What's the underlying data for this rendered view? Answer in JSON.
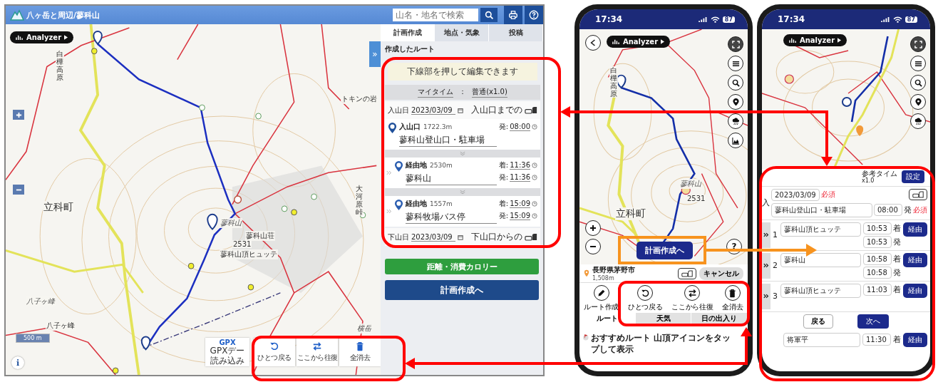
{
  "web_app": {
    "title": "八ヶ岳と周辺/蓼科山",
    "search": {
      "placeholder": "山名・地名で検索"
    },
    "map": {
      "analyzer": "Analyzer",
      "labels": [
        {
          "text": "白樺高原",
          "kind": "vertical"
        },
        {
          "text": "立科町",
          "kind": "town"
        },
        {
          "text": "蓼科山",
          "kind": "peak"
        },
        {
          "text": "蓼科山荘",
          "kind": "place"
        },
        {
          "text": "2531",
          "kind": "place"
        },
        {
          "text": "蓼科山頂ヒュッテ",
          "kind": "place"
        },
        {
          "text": "トキンの岩",
          "kind": "place"
        },
        {
          "text": "大河原峠",
          "kind": "vertical"
        },
        {
          "text": "八子ヶ峰",
          "kind": "peak"
        },
        {
          "text": "八子ヶ峰",
          "kind": "place"
        },
        {
          "text": "横岳",
          "kind": "peak"
        }
      ],
      "scale": "500 m",
      "info": "i",
      "gpx": {
        "badge": "GPX",
        "lines": [
          "GPXデー",
          "読み込み"
        ]
      },
      "tools": [
        {
          "kind": "undo",
          "label": "ひとつ戻る"
        },
        {
          "kind": "swap",
          "label": "ここから往復"
        },
        {
          "kind": "trash",
          "label": "全消去"
        }
      ]
    },
    "panel": {
      "collapse": "»",
      "tabs": [
        {
          "label": "計画作成",
          "selected": true
        },
        {
          "label": "地点・気象",
          "selected": false
        },
        {
          "label": "投稿",
          "selected": false
        }
      ],
      "heading": "作成したルート",
      "notice": "下線部を押して編集できます",
      "mytime": {
        "label": "マイタイム",
        "separator": "：",
        "value": "普通(x1.0)"
      },
      "start": {
        "label": "入山日",
        "date": "2023/03/09",
        "transport": "入山口までの"
      },
      "points": [
        {
          "kind": "start",
          "type": "入山口",
          "elevation": "1722.3m",
          "name": "蓼科山登山口・駐車場",
          "times": [
            {
              "label": "発:",
              "value": "08:00"
            }
          ]
        },
        {
          "kind": "via",
          "type": "経由地",
          "elevation": "2530m",
          "name": "蓼科山",
          "times": [
            {
              "label": "着:",
              "value": "11:36"
            },
            {
              "label": "発:",
              "value": "11:36"
            }
          ]
        },
        {
          "kind": "via",
          "type": "経由地",
          "elevation": "1557m",
          "name": "蓼科牧場バス停",
          "times": [
            {
              "label": "着:",
              "value": "15:09"
            },
            {
              "label": "発:",
              "value": "15:09"
            }
          ]
        }
      ],
      "end": {
        "label": "下山日",
        "date": "2023/03/09",
        "transport": "下山口からの"
      },
      "stats_button": "距離・消費カロリー",
      "plan_button": "計画作成へ"
    }
  },
  "phone_map": {
    "status": {
      "time": "17:34",
      "battery": "87"
    },
    "analyzer": "Analyzer",
    "labels": [
      {
        "text": "白樺高原",
        "kind": "vertical"
      },
      {
        "text": "立科町",
        "kind": "town"
      },
      {
        "text": "蓼科山",
        "kind": "peak"
      },
      {
        "text": "2531",
        "kind": "place"
      }
    ],
    "help": "?",
    "plan_button": "計画作成へ",
    "location": {
      "name": "長野県茅野市",
      "elevation": "1,508m"
    },
    "cancel": "キャンセル",
    "tools": [
      {
        "kind": "pencil",
        "label": "ルート作成"
      },
      {
        "kind": "undo",
        "label": "ひとつ戻る"
      },
      {
        "kind": "swap",
        "label": "ここから往復"
      },
      {
        "kind": "trash",
        "label": "全消去"
      }
    ],
    "tabs": [
      {
        "label": "ルート",
        "selected": true
      },
      {
        "label": "天気",
        "selected": false
      },
      {
        "label": "日の出入り",
        "selected": false
      }
    ],
    "hint": "おすすめルート 山頂アイコンをタップして表示"
  },
  "phone_edit": {
    "status": {
      "time": "17:34",
      "battery": "87"
    },
    "analyzer": "Analyzer",
    "sheet": {
      "ref_label": "参考タイム",
      "ref_value": "x1.0",
      "settings": "設定",
      "start": {
        "marker": "入",
        "date": "2023/03/09",
        "date_required": "必須",
        "name": "蓼科山登山口・駐車場",
        "time": "08:00",
        "suffix": "発",
        "time_required": "必須"
      },
      "stops": [
        {
          "number": "1",
          "name": "蓼科山頂ヒュッテ",
          "times": [
            {
              "value": "10:53",
              "suffix": "着"
            },
            {
              "value": "10:53",
              "suffix": "発"
            }
          ],
          "action": "経由"
        },
        {
          "number": "2",
          "name": "蓼科山",
          "times": [
            {
              "value": "10:58",
              "suffix": "着"
            },
            {
              "value": "10:58",
              "suffix": "発"
            }
          ],
          "action": "経由"
        },
        {
          "number": "3",
          "name": "蓼科山頂ヒュッテ",
          "times": [
            {
              "value": "11:03",
              "suffix": "着"
            }
          ],
          "action": "経由"
        }
      ],
      "back": "戻る",
      "next": "次へ",
      "last_stop": {
        "name": "将軍平",
        "time": "11:30",
        "suffix": "着",
        "action": "経由"
      }
    }
  }
}
